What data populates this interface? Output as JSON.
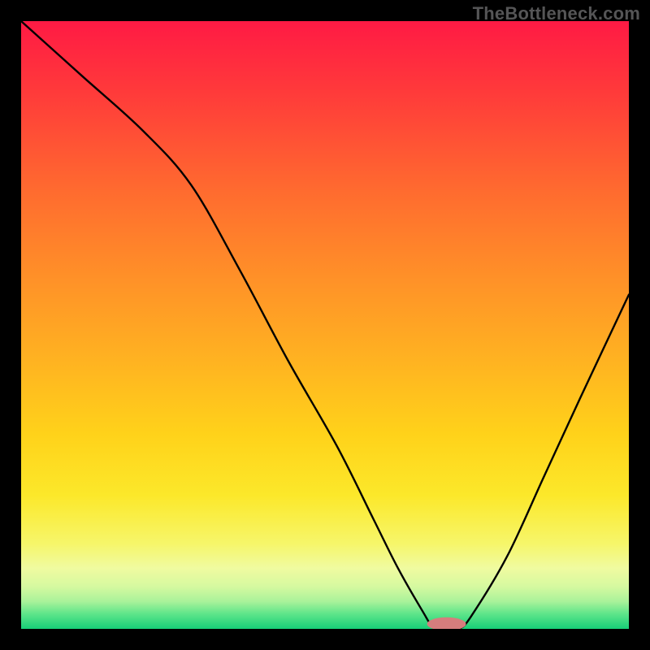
{
  "attribution": "TheBottleneck.com",
  "chart_data": {
    "type": "line",
    "title": "",
    "xlabel": "",
    "ylabel": "",
    "xlim": [
      0,
      100
    ],
    "ylim": [
      0,
      100
    ],
    "x": [
      0,
      10,
      20,
      28,
      36,
      44,
      52,
      58,
      62,
      66,
      68,
      70,
      72,
      74,
      80,
      86,
      92,
      100
    ],
    "values": [
      100,
      91,
      82,
      73,
      59,
      44,
      30,
      18,
      10,
      3,
      0,
      0,
      0,
      2,
      12,
      25,
      38,
      55
    ],
    "curve_color": "#000000",
    "marker": {
      "x": 70,
      "y": 0.8,
      "color": "#d67d7d",
      "rx": 3.2,
      "ry": 1.1
    },
    "gradient_stops": [
      {
        "offset": 0,
        "color": "#ff1a44"
      },
      {
        "offset": 12,
        "color": "#ff3b3a"
      },
      {
        "offset": 28,
        "color": "#ff6b2f"
      },
      {
        "offset": 42,
        "color": "#ff9028"
      },
      {
        "offset": 56,
        "color": "#ffb321"
      },
      {
        "offset": 68,
        "color": "#ffd21a"
      },
      {
        "offset": 78,
        "color": "#fce82a"
      },
      {
        "offset": 86,
        "color": "#f6f66a"
      },
      {
        "offset": 90,
        "color": "#f0fba0"
      },
      {
        "offset": 93,
        "color": "#d6f9a0"
      },
      {
        "offset": 95.5,
        "color": "#a9f29a"
      },
      {
        "offset": 97.5,
        "color": "#5fe58a"
      },
      {
        "offset": 100,
        "color": "#17cf78"
      }
    ]
  }
}
